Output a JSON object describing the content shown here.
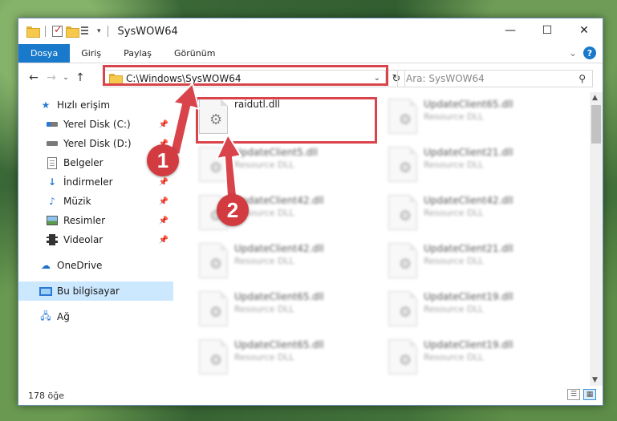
{
  "window": {
    "title": "SysWOW64",
    "minimize_label": "—",
    "maximize_label": "☐",
    "close_label": "✕"
  },
  "ribbon": {
    "tabs": [
      {
        "label": "Dosya",
        "active": true
      },
      {
        "label": "Giriş"
      },
      {
        "label": "Paylaş"
      },
      {
        "label": "Görünüm"
      }
    ],
    "collapse_label": "⌄",
    "help_label": "?"
  },
  "address": {
    "path": "C:\\Windows\\SysWOW64",
    "refresh_label": "↻"
  },
  "search": {
    "placeholder": "Ara: SysWOW64",
    "icon_label": "⚲"
  },
  "sidebar": {
    "quick_access": "Hızlı erişim",
    "items": [
      {
        "label": "Yerel Disk (C:)",
        "icon": "windows-drive-icon",
        "pinned": true
      },
      {
        "label": "Yerel Disk (D:)",
        "icon": "drive-icon",
        "pinned": true
      },
      {
        "label": "Belgeler",
        "icon": "documents-icon",
        "pinned": true
      },
      {
        "label": "İndirmeler",
        "icon": "downloads-icon",
        "pinned": true
      },
      {
        "label": "Müzik",
        "icon": "music-icon",
        "pinned": true
      },
      {
        "label": "Resimler",
        "icon": "pictures-icon",
        "pinned": true
      },
      {
        "label": "Videolar",
        "icon": "videos-icon",
        "pinned": true
      }
    ],
    "onedrive": "OneDrive",
    "this_pc": "Bu bilgisayar",
    "network": "Ağ"
  },
  "files": [
    {
      "name": "raidutl.dll",
      "type": ""
    },
    {
      "name": "UpdateClient65.dll",
      "type": "Resource DLL"
    },
    {
      "name": "UpdateClient5.dll",
      "type": "Resource DLL"
    },
    {
      "name": "UpdateClient21.dll",
      "type": "Resource DLL"
    },
    {
      "name": "UpdateClient42.dll",
      "type": "Resource DLL"
    },
    {
      "name": "UpdateClient42.dll",
      "type": "Resource DLL"
    },
    {
      "name": "UpdateClient42.dll",
      "type": "Resource DLL"
    },
    {
      "name": "UpdateClient21.dll",
      "type": "Resource DLL"
    },
    {
      "name": "UpdateClient65.dll",
      "type": "Resource DLL"
    },
    {
      "name": "UpdateClient19.dll",
      "type": "Resource DLL"
    },
    {
      "name": "UpdateClient65.dll",
      "type": "Resource DLL"
    },
    {
      "name": "UpdateClient19.dll",
      "type": "Resource DLL"
    }
  ],
  "status": {
    "item_count": "178 öğe"
  },
  "annotations": {
    "badge1": "1",
    "badge2": "2",
    "color": "#d9444b"
  }
}
